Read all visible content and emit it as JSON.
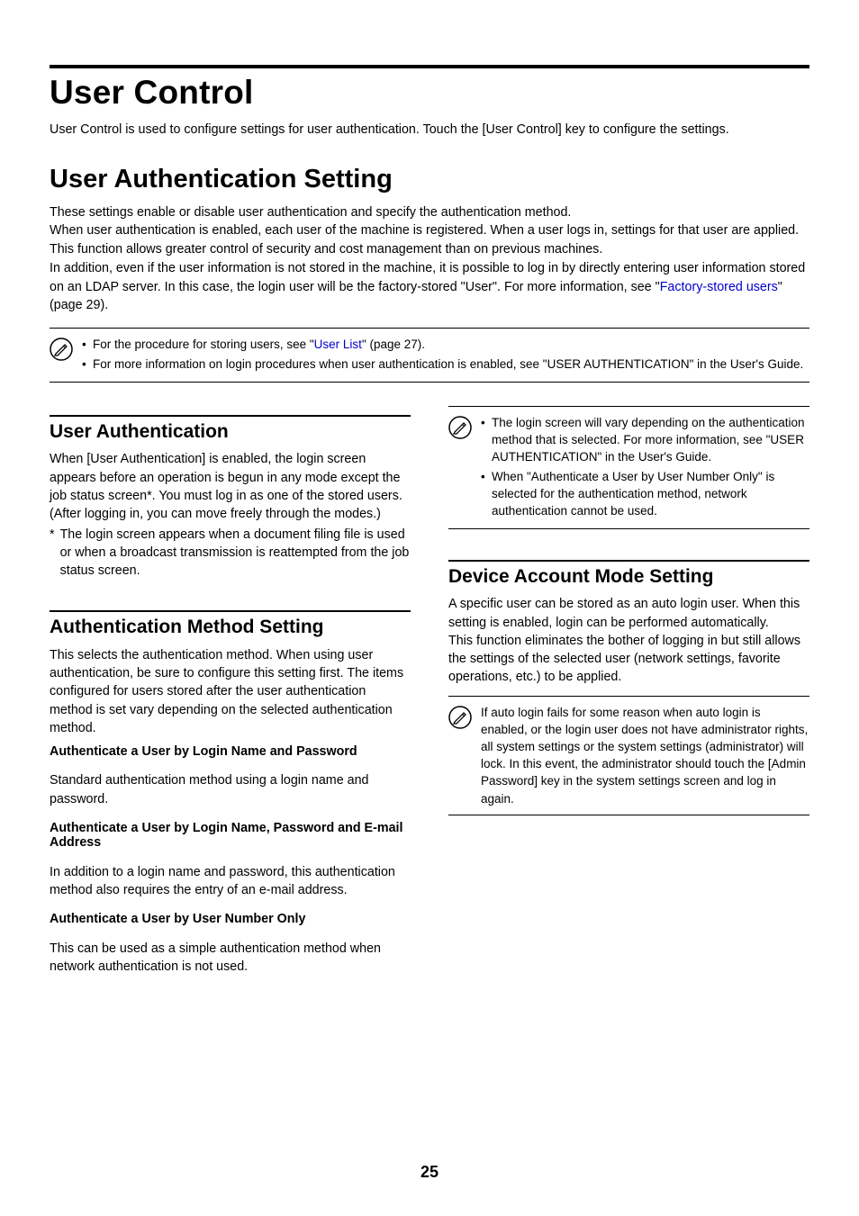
{
  "chapter": {
    "title": "User Control",
    "intro": "User Control is used to configure settings for user authentication. Touch the [User Control] key to configure the settings."
  },
  "section": {
    "title": "User Authentication Setting",
    "p1": "These settings enable or disable user authentication and specify the authentication method.",
    "p2": "When user authentication is enabled, each user of the machine is registered. When a user logs in, settings for that user are applied. This function allows greater control of security and cost management than on previous machines.",
    "p3": "In addition, even if the user information is not stored in the machine, it is possible to log in by directly entering user information stored on an LDAP server. In this case, the login user will be the factory-stored \"User\". For more information, see \"",
    "p3_link": "Factory-stored users",
    "p3_after": "\" (page 29)."
  },
  "top_note": {
    "item1_before": "For the procedure for storing users, see \"",
    "item1_link": "User List",
    "item1_after": "\" (page 27).",
    "item2": "For more information on login procedures when user authentication is enabled, see \"USER AUTHENTICATION\" in the User's Guide."
  },
  "left": {
    "h1": "User Authentication",
    "h1_body": "When [User Authentication] is enabled, the login screen appears before an operation is begun in any mode except the job status screen*. You must log in as one of the stored users. (After logging in, you can move freely through the modes.)",
    "h1_footnote": "The login screen appears when a document filing file is used or when a broadcast transmission is reattempted from the job status screen.",
    "h2": "Authentication Method Setting",
    "h2_body": "This selects the authentication method. When using user authentication, be sure to configure this setting first. The items configured for users stored after the user authentication method is set vary depending on the selected authentication method.",
    "m1_title": "Authenticate a User by Login Name and Password",
    "m1_body": "Standard authentication method using a login name and password.",
    "m2_title": "Authenticate a User by Login Name, Password and E-mail Address",
    "m2_body": "In addition to a login name and password, this authentication method also requires the entry of an e-mail address.",
    "m3_title": "Authenticate a User by User Number Only",
    "m3_body": "This can be used as a simple authentication method when network authentication is not used."
  },
  "right": {
    "note1_item1": "The login screen will vary depending on the authentication method that is selected. For more information, see \"USER AUTHENTICATION\" in the User's Guide.",
    "note1_item2": "When \"Authenticate a User by User Number Only\" is selected for the authentication method, network authentication cannot be used.",
    "h3": "Device Account Mode Setting",
    "h3_p1": "A specific user can be stored as an auto login user. When this setting is enabled, login can be performed automatically.",
    "h3_p2": "This function eliminates the bother of logging in but still allows the settings of the selected user (network settings, favorite operations, etc.) to be applied.",
    "note2": "If auto login fails for some reason when auto login is enabled, or the login user does not have administrator rights, all system settings or the system settings (administrator) will lock. In this event, the administrator should touch the [Admin Password] key in the system settings screen and log in again."
  },
  "page_number": "25"
}
